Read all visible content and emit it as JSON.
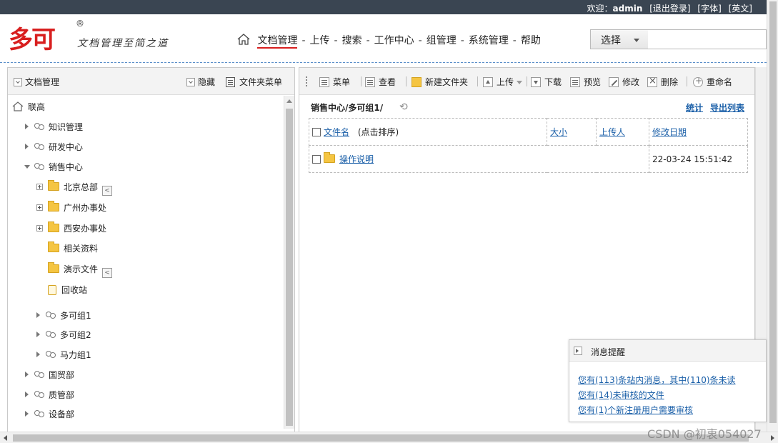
{
  "topbar": {
    "welcome": "欢迎：",
    "username": "admin",
    "logout": "[退出登录]",
    "font": "[字体]",
    "english": "[英文]"
  },
  "brand": {
    "logo_text": "多可",
    "registered": "®",
    "slogan": "文档管理至简之道"
  },
  "nav": {
    "items": [
      "文档管理",
      "上传",
      "搜索",
      "工作中心",
      "组管理",
      "系统管理",
      "帮助"
    ],
    "separator": "-"
  },
  "search": {
    "select_label": "选择",
    "input_value": ""
  },
  "left_panel": {
    "title": "文档管理",
    "hide": "隐藏",
    "folder_menu": "文件夹菜单",
    "tree": {
      "root": "联高",
      "knowledge": "知识管理",
      "rnd": "研发中心",
      "sales": "销售中心",
      "beijing": "北京总部",
      "guangzhou": "广州办事处",
      "xian": "西安办事处",
      "related": "相关资料",
      "demo": "演示文件",
      "recycle": "回收站",
      "group1": "多可组1",
      "group2": "多可组2",
      "group3": "马力组1",
      "trade": "国贸部",
      "quality": "质管部",
      "equipment": "设备部"
    }
  },
  "toolbar": {
    "menu": "菜单",
    "view": "查看",
    "new_folder": "新建文件夹",
    "upload": "上传",
    "download": "下载",
    "preview": "预览",
    "edit": "修改",
    "delete": "删除",
    "rename": "重命名"
  },
  "content": {
    "path": "销售中心/多可组1/",
    "stats": "统计",
    "export": "导出列表",
    "columns": {
      "name": "文件名",
      "sort_hint": "(点击排序)",
      "size": "大小",
      "uploader": "上传人",
      "modified": "修改日期"
    },
    "rows": [
      {
        "name": "操作说明",
        "size": "",
        "uploader": "",
        "modified": "22-03-24 15:51:42"
      }
    ]
  },
  "messages": {
    "title": "消息提醒",
    "items": [
      "您有(113)条站内消息，其中(110)条未读",
      "您有(14)未审核的文件",
      "您有(1)个新注册用户需要审核"
    ]
  },
  "watermark": "CSDN @初衷054027",
  "colors": {
    "topbar_bg": "#3a4552",
    "brand_red": "#d81e1e",
    "link_blue": "#1a5fa8",
    "folder_yellow": "#f5c542"
  }
}
